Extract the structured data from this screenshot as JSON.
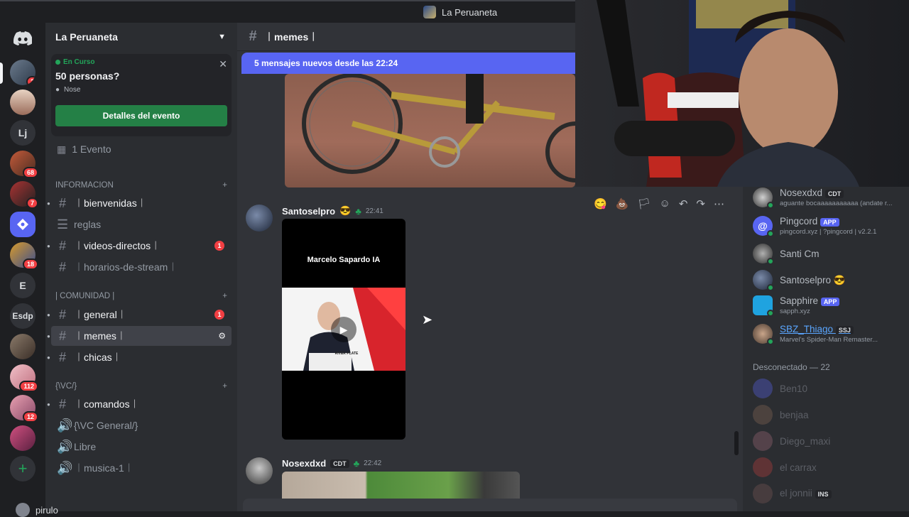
{
  "window": {
    "title": "La Peruaneta"
  },
  "rail": {
    "servers": [
      {
        "name": "discord-home",
        "label": "",
        "badge": ""
      },
      {
        "name": "server-1",
        "label": "",
        "badge": "2"
      },
      {
        "name": "server-2",
        "label": "",
        "badge": ""
      },
      {
        "name": "server-lj",
        "label": "Lj",
        "badge": ""
      },
      {
        "name": "server-4",
        "label": "",
        "badge": "68"
      },
      {
        "name": "server-5",
        "label": "",
        "badge": "7"
      },
      {
        "name": "server-6",
        "label": "",
        "badge": ""
      },
      {
        "name": "server-7",
        "label": "",
        "badge": "18"
      },
      {
        "name": "server-e",
        "label": "E",
        "badge": ""
      },
      {
        "name": "server-esdp",
        "label": "Esdp",
        "badge": ""
      },
      {
        "name": "server-10",
        "label": "",
        "badge": ""
      },
      {
        "name": "server-11",
        "label": "",
        "badge": "112"
      },
      {
        "name": "server-12",
        "label": "",
        "badge": "12"
      },
      {
        "name": "server-13",
        "label": "",
        "badge": ""
      }
    ],
    "add_label": "+"
  },
  "sidebar": {
    "server_name": "La Peruaneta",
    "event": {
      "status": "En Curso",
      "title": "50 personas?",
      "location": "Nose",
      "button": "Detalles del evento"
    },
    "events_count": "1 Evento",
    "categories": {
      "informacion": "INFORMACION",
      "comunidad": "| COMUNIDAD |",
      "vc": "{\\VC/}"
    },
    "channels": {
      "bienvenidas": "︱bienvenidas︱",
      "reglas": "reglas",
      "videos": "︱videos-directos︱",
      "videos_unread": "1",
      "horarios": "︱horarios-de-stream︱",
      "general": "︱general︱",
      "general_unread": "1",
      "memes": "︱memes︱",
      "chicas": "︱chicas︱",
      "comandos": "︱comandos︱",
      "vc_general": "{\\VC General/}",
      "libre": "Libre",
      "musica": "︱musica-1︱"
    },
    "user": "pirulo"
  },
  "chat": {
    "channel": "︱memes︱",
    "new_messages": "5 mensajes nuevos desde las 22:24",
    "messages": [
      {
        "author": "Santoselpro",
        "time": "22:41",
        "video_text": "Marcelo Sapardo IA",
        "podium_text": "RIVER PLATE"
      },
      {
        "author": "Nosexdxd",
        "tag": "CDT",
        "time": "22:42"
      }
    ]
  },
  "members": {
    "online": [
      {
        "name": "Nosexdxd",
        "tag": "CDT",
        "sub": "aguante bocaaaaaaaaaaa (andate r..."
      },
      {
        "name": "Pingcord",
        "tag": "APP",
        "sub": "pingcord.xyz | ?pingcord | v2.2.1"
      },
      {
        "name": "Santi Cm",
        "tag": "",
        "sub": ""
      },
      {
        "name": "Santoselpro",
        "tag": "",
        "sub": ""
      },
      {
        "name": "Sapphire",
        "tag": "APP",
        "sub": "sapph.xyz"
      },
      {
        "name": "SBZ_Thiago",
        "tag": "SSJ",
        "sub": "Marvel's Spider-Man Remaster..."
      }
    ],
    "offline_header": "Desconectado — 22",
    "offline": [
      "Ben10",
      "benjaa",
      "Diego_maxi",
      "el carrax",
      "el jonnii"
    ],
    "offline_extra_tag": "INS"
  },
  "colors": {
    "accent": "#5865f2",
    "green": "#248046",
    "red": "#f23f43",
    "online": "#23a55a"
  }
}
